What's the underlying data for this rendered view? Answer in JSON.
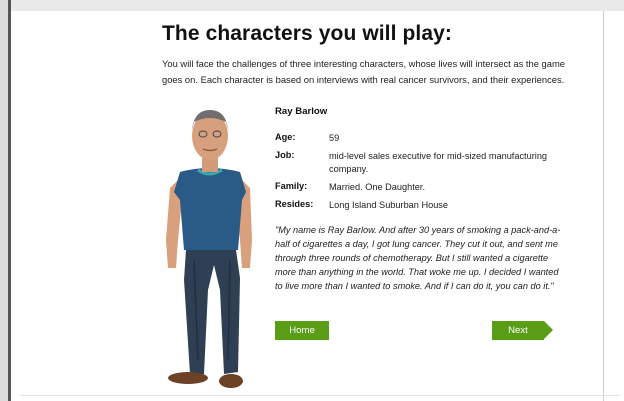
{
  "page": {
    "title": "The characters you will play:",
    "intro": "You will face the challenges of three interesting characters, whose lives will intersect as the game goes on. Each character is based on interviews with real cancer survivors, and their experiences."
  },
  "character": {
    "name": "Ray Barlow",
    "facts": [
      {
        "label": "Age:",
        "value": "59"
      },
      {
        "label": "Job:",
        "value": "mid-level sales executive for mid-sized manufacturing company."
      },
      {
        "label": "Family:",
        "value": "Married. One Daughter."
      },
      {
        "label": "Resides:",
        "value": "Long Island Suburban House"
      }
    ],
    "quote": "\"My name is Ray Barlow. And after 30 years of smoking a pack-and-a-half of cigarettes a day, I got lung cancer. They cut it out, and sent me through three rounds of chemotherapy. But I still wanted a cigarette more than anything in the world. That woke me up. I decided I wanted to live more than I wanted to smoke. And if I can do it, you can do it.\""
  },
  "nav": {
    "home_label": "Home",
    "next_label": "Next"
  },
  "colors": {
    "button": "#5a9e18",
    "shirt": "#2a5a86",
    "jeans": "#2f4055"
  }
}
